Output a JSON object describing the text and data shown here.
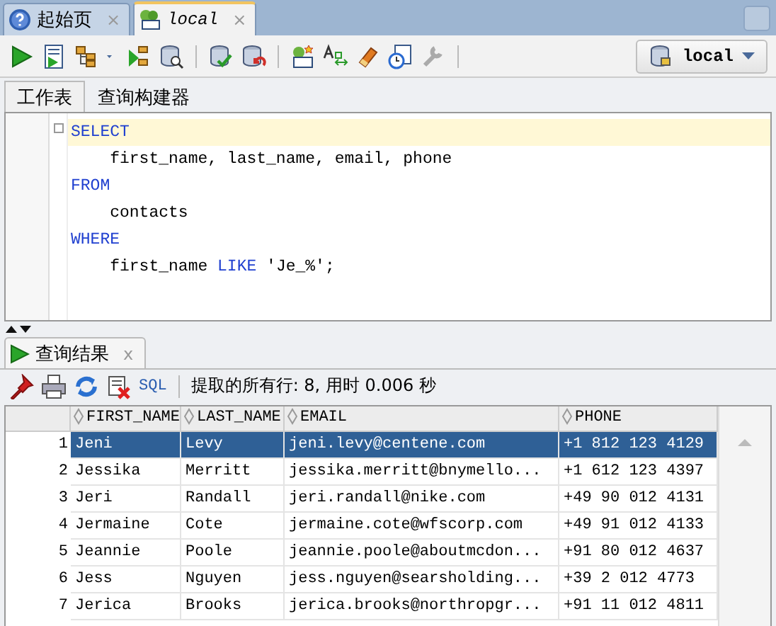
{
  "doc_tabs": [
    {
      "label": "起始页",
      "close": "×",
      "kind": "help",
      "selected": false
    },
    {
      "label": "local",
      "close": "×",
      "kind": "sql",
      "selected": true
    }
  ],
  "connection": {
    "label": "local"
  },
  "editor_tabs": [
    {
      "label": "工作表",
      "selected": true
    },
    {
      "label": "查询构建器",
      "selected": false
    }
  ],
  "code_lines": [
    {
      "kind": "keyword",
      "text": "SELECT",
      "current": true
    },
    {
      "kind": "plain",
      "text": "    first_name, last_name, email, phone",
      "current": false
    },
    {
      "kind": "keyword",
      "text": "FROM",
      "current": false
    },
    {
      "kind": "plain",
      "text": "    contacts",
      "current": false
    },
    {
      "kind": "keyword",
      "text": "WHERE",
      "current": false
    },
    {
      "kind": "mixed",
      "text": "    first_name ",
      "keyword": "LIKE",
      "rest": " 'Je_%';",
      "current": false
    }
  ],
  "results_tab": {
    "label": "查询结果",
    "close": "x"
  },
  "results_toolbar": {
    "sql": "SQL",
    "status": "提取的所有行: 8, 用时 0.006 秒"
  },
  "table": {
    "columns": [
      "FIRST_NAME",
      "LAST_NAME",
      "EMAIL",
      "PHONE"
    ],
    "rows": [
      {
        "num": "1",
        "cells": [
          "Jeni",
          "Levy",
          "jeni.levy@centene.com",
          "+1 812 123 4129"
        ],
        "selected": true
      },
      {
        "num": "2",
        "cells": [
          "Jessika",
          "Merritt",
          "jessika.merritt@bnymello...",
          "+1 612 123 4397"
        ],
        "selected": false
      },
      {
        "num": "3",
        "cells": [
          "Jeri",
          "Randall",
          "jeri.randall@nike.com",
          "+49 90 012 4131"
        ],
        "selected": false
      },
      {
        "num": "4",
        "cells": [
          "Jermaine",
          "Cote",
          "jermaine.cote@wfscorp.com",
          "+49 91 012 4133"
        ],
        "selected": false
      },
      {
        "num": "5",
        "cells": [
          "Jeannie",
          "Poole",
          "jeannie.poole@aboutmcdon...",
          "+91 80 012 4637"
        ],
        "selected": false
      },
      {
        "num": "6",
        "cells": [
          "Jess",
          "Nguyen",
          "jess.nguyen@searsholding...",
          "+39 2 012 4773"
        ],
        "selected": false
      },
      {
        "num": "7",
        "cells": [
          "Jerica",
          "Brooks",
          "jerica.brooks@northropgr...",
          "+91 11 012 4811"
        ],
        "selected": false
      }
    ]
  }
}
